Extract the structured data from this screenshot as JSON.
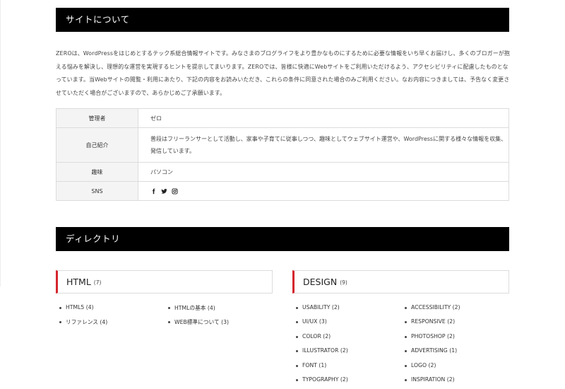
{
  "about": {
    "heading": "サイトについて",
    "intro": "ZEROは、WordPressをはじめとするテック系総合情報サイトです。みなさまのブログライフをより豊かなものにするために必要な情報をいち早くお届けし、多くのブロガーが抱える悩みを解決し、理想的な運営を実現するヒントを提示してまいります。ZEROでは、皆様に快適にWebサイトをご利用いただけるよう、アクセシビリティに配慮したものとなっています。当Webサイトの閲覧・利用にあたり、下記の内容をお読みいただき、これらの条件に同意された場合のみご利用ください。なお内容につきましては、予告なく変更させていただく場合がございますので、あらかじめご了承願います。",
    "profile": [
      {
        "label": "管理者",
        "value": "ゼロ"
      },
      {
        "label": "自己紹介",
        "value": "普段はフリーランサーとして活動し、家事や子育てに従事しつつ、趣味としてウェブサイト運営や、WordPressに関する様々な情報を収集、発信しています。"
      },
      {
        "label": "趣味",
        "value": "パソコン"
      },
      {
        "label": "SNS",
        "icons": [
          "facebook-icon",
          "twitter-icon",
          "instagram-icon"
        ]
      }
    ]
  },
  "directory": {
    "heading": "ディレクトリ",
    "categories": [
      {
        "title": "HTML",
        "count": "(7)",
        "items": [
          "HTML5 (4)",
          "HTMLの基本 (4)",
          "リファレンス (4)",
          "WEB標準について (3)"
        ]
      },
      {
        "title": "DESIGN",
        "count": "(9)",
        "items": [
          "USABILITY (2)",
          "ACCESSIBILITY (2)",
          "UI/UX (3)",
          "RESPONSIVE (2)",
          "COLOR (2)",
          "PHOTOSHOP (2)",
          "ILLUSTRATOR (2)",
          "ADVERTISING (1)",
          "FONT (1)",
          "LOGO (2)",
          "TYPOGRAPHY (2)",
          "INSPIRATION (2)"
        ]
      }
    ]
  },
  "colors": {
    "bar": "#000000",
    "accent": "#d5262d",
    "border": "#dcdcdc",
    "th_bg": "#f4f4f4"
  }
}
